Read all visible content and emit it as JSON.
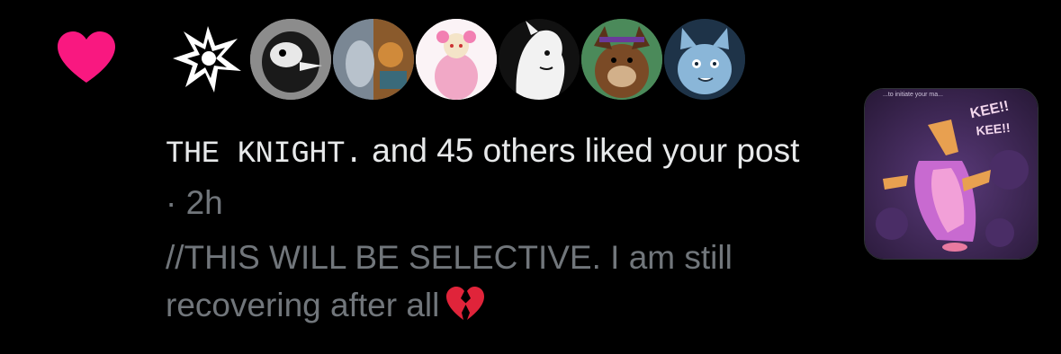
{
  "colors": {
    "heart": "#f91880",
    "background": "#000000",
    "primary_text": "#e7e9ea",
    "secondary_text": "#71767b"
  },
  "notification": {
    "icon": "heart-icon",
    "actor_name": "THE KNIGHT.",
    "liked_text": " and 45 others liked your post",
    "separator": " · ",
    "time": "2h",
    "preview_text": "//THIS WILL BE SELECTIVE. I am still recovering after all",
    "preview_emoji": "broken-heart-icon",
    "avatars": [
      {
        "name": "avatar-1"
      },
      {
        "name": "avatar-2"
      },
      {
        "name": "avatar-3"
      },
      {
        "name": "avatar-4"
      },
      {
        "name": "avatar-5"
      },
      {
        "name": "avatar-6"
      },
      {
        "name": "avatar-7"
      },
      {
        "name": "avatar-8"
      }
    ],
    "thumbnail": {
      "caption_top": "...to initiate your ma...",
      "caption_kee1": "KEE!!",
      "caption_kee2": "KEE!!"
    }
  }
}
